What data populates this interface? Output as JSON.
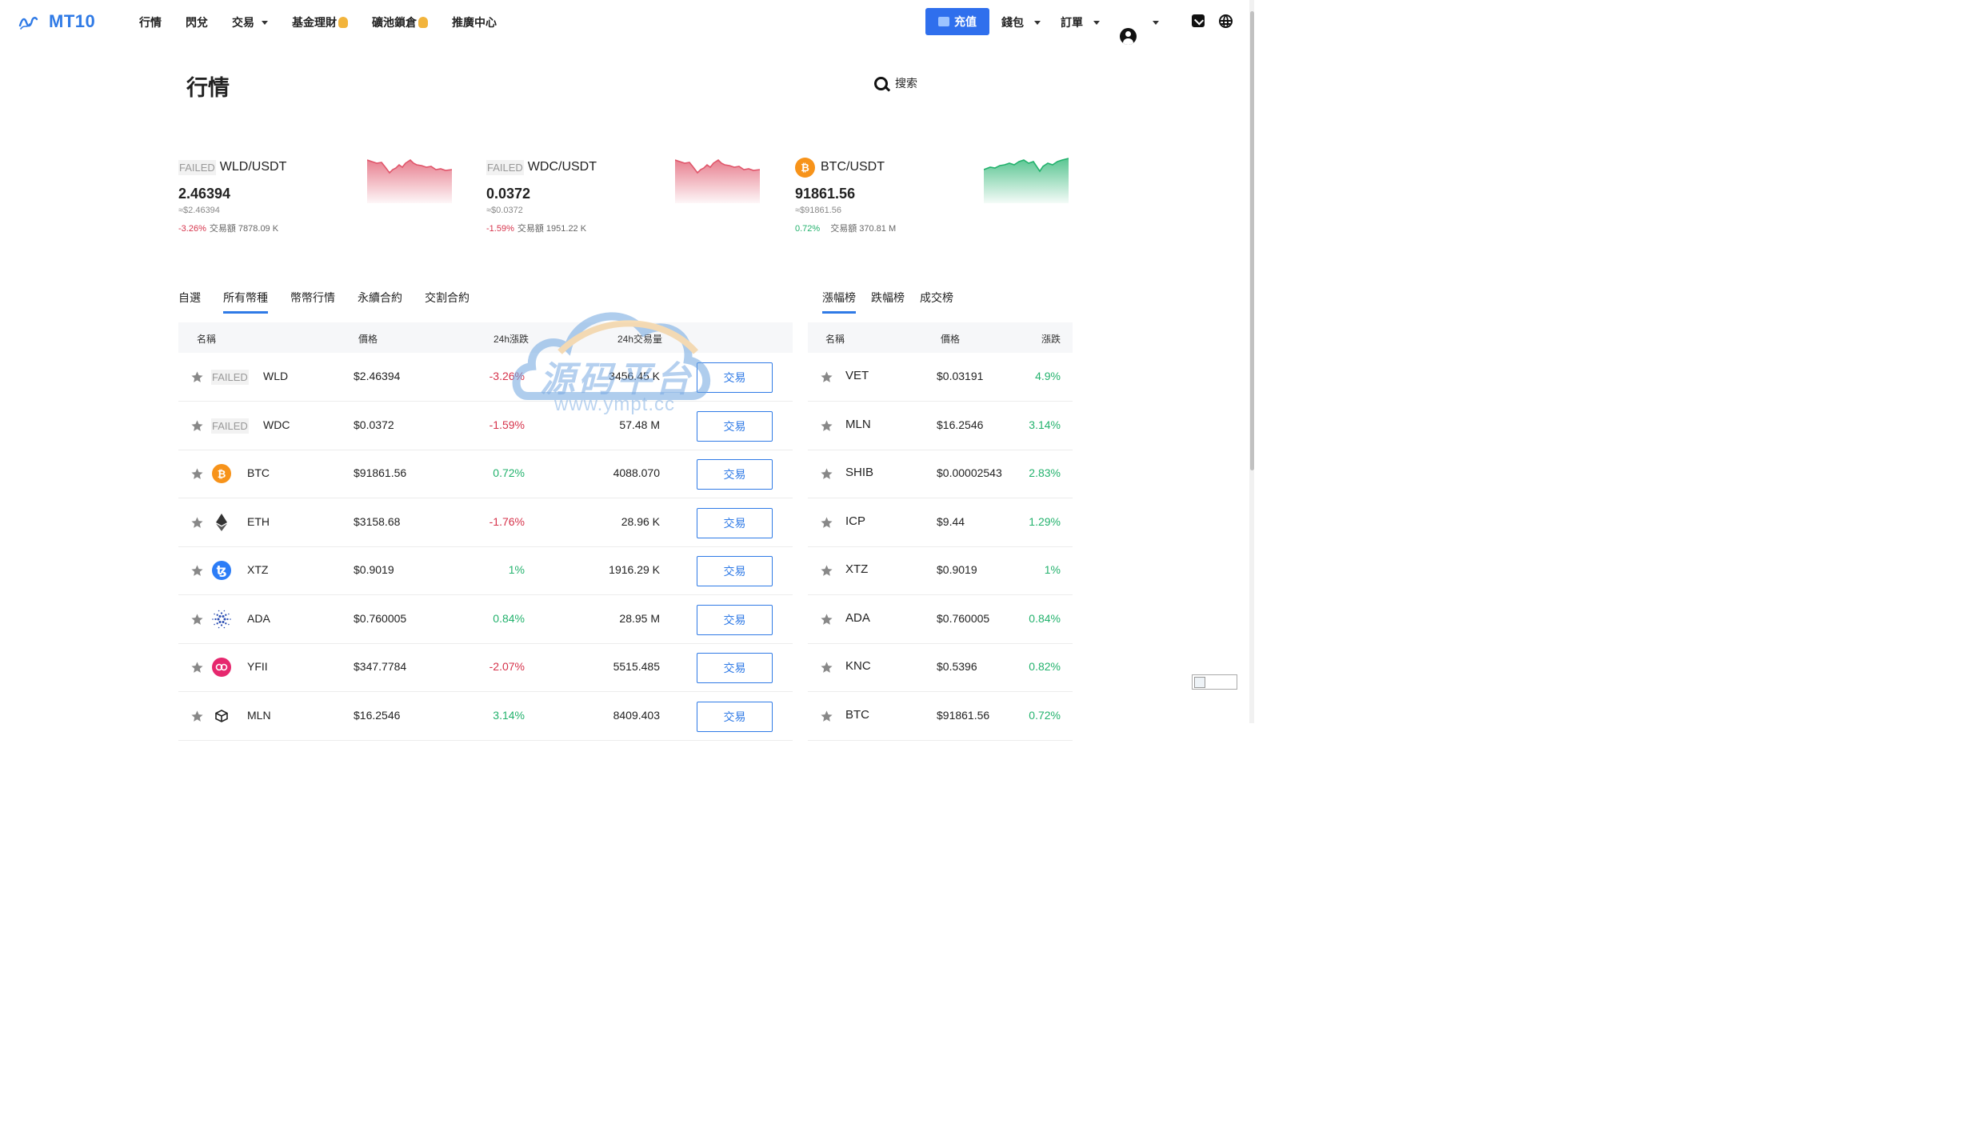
{
  "nav": {
    "logo_text": "MT10",
    "links": [
      {
        "label": "行情",
        "dropdown": false,
        "hot": false
      },
      {
        "label": "閃兌",
        "dropdown": false,
        "hot": false
      },
      {
        "label": "交易",
        "dropdown": true,
        "hot": false
      },
      {
        "label": "基金理財",
        "dropdown": false,
        "hot": true
      },
      {
        "label": "礦池鎖倉",
        "dropdown": false,
        "hot": true
      },
      {
        "label": "推廣中心",
        "dropdown": false,
        "hot": false
      }
    ],
    "deposit_label": "充值",
    "wallet_label": "錢包",
    "orders_label": "訂單",
    "accent_color": "#2f6fed"
  },
  "header": {
    "title": "行情",
    "search_label": "搜索"
  },
  "cards": [
    {
      "failed": "FAILED",
      "pair": "WLD/USDT",
      "price": "2.46394",
      "approx": "≈$2.46394",
      "change": "-3.26%",
      "direction": "down",
      "volume": "交易額 7878.09 K"
    },
    {
      "failed": "FAILED",
      "pair": "WDC/USDT",
      "price": "0.0372",
      "approx": "≈$0.0372",
      "change": "-1.59%",
      "direction": "down",
      "volume": "交易額 1951.22 K"
    },
    {
      "failed": "",
      "icon": "bitcoin-icon",
      "pair": "BTC/USDT",
      "price": "91861.56",
      "approx": "≈$91861.56",
      "change": "0.72%",
      "direction": "up",
      "volume": "交易額 370.81 M"
    }
  ],
  "tabs": [
    {
      "label": "自選",
      "active": false
    },
    {
      "label": "所有幣種",
      "active": true
    },
    {
      "label": "幣幣行情",
      "active": false
    },
    {
      "label": "永續合約",
      "active": false
    },
    {
      "label": "交割合約",
      "active": false
    }
  ],
  "rank_tabs": [
    {
      "label": "漲幅榜",
      "active": true
    },
    {
      "label": "跌幅榜",
      "active": false
    },
    {
      "label": "成交榜",
      "active": false
    }
  ],
  "table": {
    "headers": {
      "name": "名稱",
      "price": "價格",
      "change": "24h漲跌",
      "volume": "24h交易量"
    },
    "trade_label": "交易",
    "rows": [
      {
        "failed": "FAILED",
        "icon": "",
        "icon_color": "",
        "name": "WLD",
        "price": "$2.46394",
        "change": "-3.26%",
        "direction": "down",
        "volume": "3456.45 K"
      },
      {
        "failed": "FAILED",
        "icon": "",
        "icon_color": "",
        "name": "WDC",
        "price": "$0.0372",
        "change": "-1.59%",
        "direction": "down",
        "volume": "57.48 M"
      },
      {
        "failed": "",
        "icon": "bitcoin-icon",
        "icon_color": "#f7931a",
        "name": "BTC",
        "price": "$91861.56",
        "change": "0.72%",
        "direction": "up",
        "volume": "4088.070"
      },
      {
        "failed": "",
        "icon": "ethereum-icon",
        "icon_color": "#ffffff",
        "name": "ETH",
        "price": "$3158.68",
        "change": "-1.76%",
        "direction": "down",
        "volume": "28.96 K"
      },
      {
        "failed": "",
        "icon": "tezos-icon",
        "icon_color": "#2c7df7",
        "name": "XTZ",
        "price": "$0.9019",
        "change": "1%",
        "direction": "up",
        "volume": "1916.29 K"
      },
      {
        "failed": "",
        "icon": "cardano-icon",
        "icon_color": "#ffffff",
        "name": "ADA",
        "price": "$0.760005",
        "change": "0.84%",
        "direction": "up",
        "volume": "28.95 M"
      },
      {
        "failed": "",
        "icon": "yfii-icon",
        "icon_color": "#e6286e",
        "name": "YFII",
        "price": "$347.7784",
        "change": "-2.07%",
        "direction": "down",
        "volume": "5515.485"
      },
      {
        "failed": "",
        "icon": "melon-icon",
        "icon_color": "#ffffff",
        "name": "MLN",
        "price": "$16.2546",
        "change": "3.14%",
        "direction": "up",
        "volume": "8409.403"
      }
    ]
  },
  "rank_table": {
    "headers": {
      "name": "名稱",
      "price": "價格",
      "change": "漲跌"
    },
    "rows": [
      {
        "name": "VET",
        "price": "$0.03191",
        "change": "4.9%"
      },
      {
        "name": "MLN",
        "price": "$16.2546",
        "change": "3.14%"
      },
      {
        "name": "SHIB",
        "price": "$0.00002543",
        "change": "2.83%"
      },
      {
        "name": "ICP",
        "price": "$9.44",
        "change": "1.29%"
      },
      {
        "name": "XTZ",
        "price": "$0.9019",
        "change": "1%"
      },
      {
        "name": "ADA",
        "price": "$0.760005",
        "change": "0.84%"
      },
      {
        "name": "KNC",
        "price": "$0.5396",
        "change": "0.82%"
      },
      {
        "name": "BTC",
        "price": "$91861.56",
        "change": "0.72%"
      }
    ]
  },
  "watermark": {
    "text": "源码平台",
    "url": "www.ympt.cc"
  },
  "colors": {
    "up": "#23b26d",
    "down": "#d6334b",
    "accent": "#2f7ae6"
  }
}
